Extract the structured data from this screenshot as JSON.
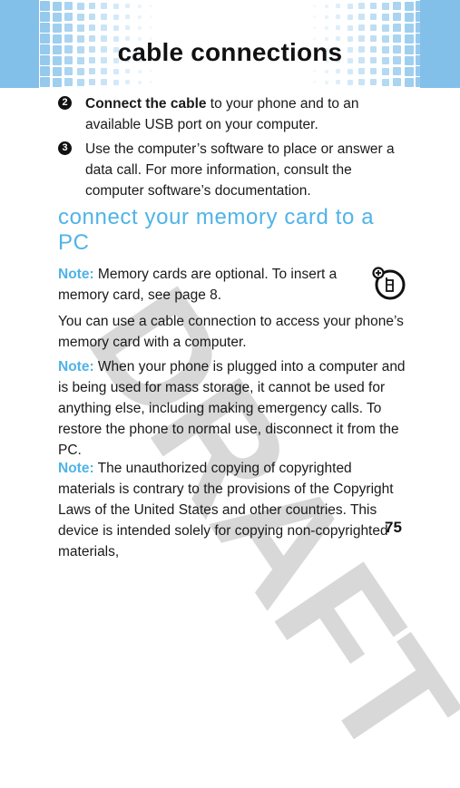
{
  "header": {
    "title": "cable connections"
  },
  "watermark": "DRAFT",
  "steps": [
    {
      "number": "2",
      "bold": "Connect the cable",
      "text": " to your phone and to an available USB port on your computer."
    },
    {
      "number": "3",
      "bold": "",
      "text": "Use the computer’s software to place or answer a data call. For more information, consult the computer software’s documentation."
    }
  ],
  "section": {
    "heading": "connect your memory card to a PC"
  },
  "paragraphs": [
    {
      "label": "Note:",
      "text": " Memory cards are optional. To insert a memory card, see page 8."
    },
    {
      "label": "",
      "text": "You can use a cable connection to access your phone’s memory card with a computer."
    },
    {
      "label": "Note:",
      "text": " When your phone is plugged into a computer and is being used for mass storage, it cannot be used for anything else, including making emergency calls. To restore the phone to normal use, disconnect it from the PC."
    },
    {
      "label": "Note:",
      "text": " The unauthorized copying of copyrighted materials is contrary to the provisions of the Copyright Laws of the United States and other countries. This device is intended solely for copying non-copyrighted materials,"
    }
  ],
  "icons": {
    "accessory": "memory-card-accessory-icon"
  },
  "colors": {
    "accent": "#4fb3e8",
    "band": "#82c0ea"
  },
  "page_number": "75"
}
